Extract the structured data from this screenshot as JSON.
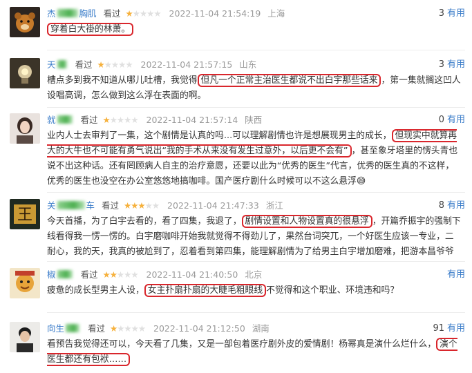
{
  "reviews": [
    {
      "user": "杰",
      "user_tail": "胸肌",
      "kan": "看过",
      "stars": 1,
      "date": "2022-11-04 21:54:19",
      "loc": "上海",
      "useful_count": "3",
      "useful_label": "有用",
      "text_pre": "",
      "text_hl": "穿着白大褂的林萧。",
      "text_post": ""
    },
    {
      "user": "天",
      "user_tail": "",
      "kan": "看过",
      "stars": 1,
      "date": "2022-11-04 21:57:15",
      "loc": "山东",
      "useful_count": "3",
      "useful_label": "有用",
      "text_pre": "槽点多到我不知道从哪儿吐槽，我觉得",
      "text_hl": "但凡一个正常主治医生都说不出白宇那些话来",
      "text_post": "，第一集就搁这凹人设唱高调，怎么做到这么浮在表面的啊。"
    },
    {
      "user": "就",
      "user_tail": "",
      "kan": "看过",
      "stars": 1,
      "date": "2022-11-04 21:57:14",
      "loc": "陕西",
      "useful_count": "0",
      "useful_label": "有用",
      "text_pre": "业内人士去审判了一集，这个剧情是认真的吗...可以理解剧情也许是想展现男主的成长，",
      "text_hl": "但现实中就算再大的大牛也不可能有勇气说出“我的手术从来没有发生过意外，以后更不会有”",
      "text_post": "，甚至象牙塔里的愣头青也说不出这种话。还有罔顾病人自主的治疗意愿，还要以此为“优秀的医生”代言，优秀的医生真的不这样，优秀的医生也没空在办公室悠悠地搞咖啡。国产医疗剧什么时候可以不这么悬浮",
      "emoji": "😅"
    },
    {
      "user": "关",
      "user_tail": "车",
      "kan": "看过",
      "stars": 3,
      "date": "2022-11-04 21:47:33",
      "loc": "浙江",
      "useful_count": "8",
      "useful_label": "有用",
      "text_pre": "今天首播，为了白宇去看的，看了四集，我退了，",
      "text_hl": "剧情设置和人物设置真的很悬浮",
      "text_post": "，开篇乔振宇的强制下线看得我一愣一愣的。白宇磨咖啡开始我就觉得不得劲儿了，果然台词突兀，一个好医生应该一专业，二耐心，我的天，我真的被尬到了，忍着看到第四集，能理解剧情为了给男主白宇增加磨难，把游本昌爷爷写下"
    },
    {
      "user": "椒",
      "user_tail": "",
      "kan": "看过",
      "stars": 2,
      "date": "2022-11-04 21:40:50",
      "loc": "北京",
      "useful_count": "",
      "useful_label": "有用",
      "text_pre": "疲惫的成长型男主人设，",
      "text_hl": "女主扑扇扑扇的大睫毛粗眼线",
      "text_post": "不觉得和这个职业、环境违和吗？"
    },
    {
      "user": "向生",
      "user_tail": "",
      "kan": "看过",
      "stars": 1,
      "date": "2022-11-04 21:12:50",
      "loc": "湖南",
      "useful_count": "91",
      "useful_label": "有用",
      "text_pre": "看预告我觉得还可以，今天看了几集，又是一部包着医疗剧外皮的爱情剧！杨幂真是演什么烂什么，",
      "text_hl": "演个医生都还有包袱……",
      "text_post": ""
    }
  ],
  "avatars": [
    "bear-avatar-icon",
    "bulb-avatar-icon",
    "woman-avatar-icon",
    "king-avatar-icon",
    "cartoon-avatar-icon",
    "man-avatar-icon"
  ],
  "colors": {
    "username": "#3a7cc9",
    "star": "#f6b13c",
    "highlight": "#d9262c"
  }
}
